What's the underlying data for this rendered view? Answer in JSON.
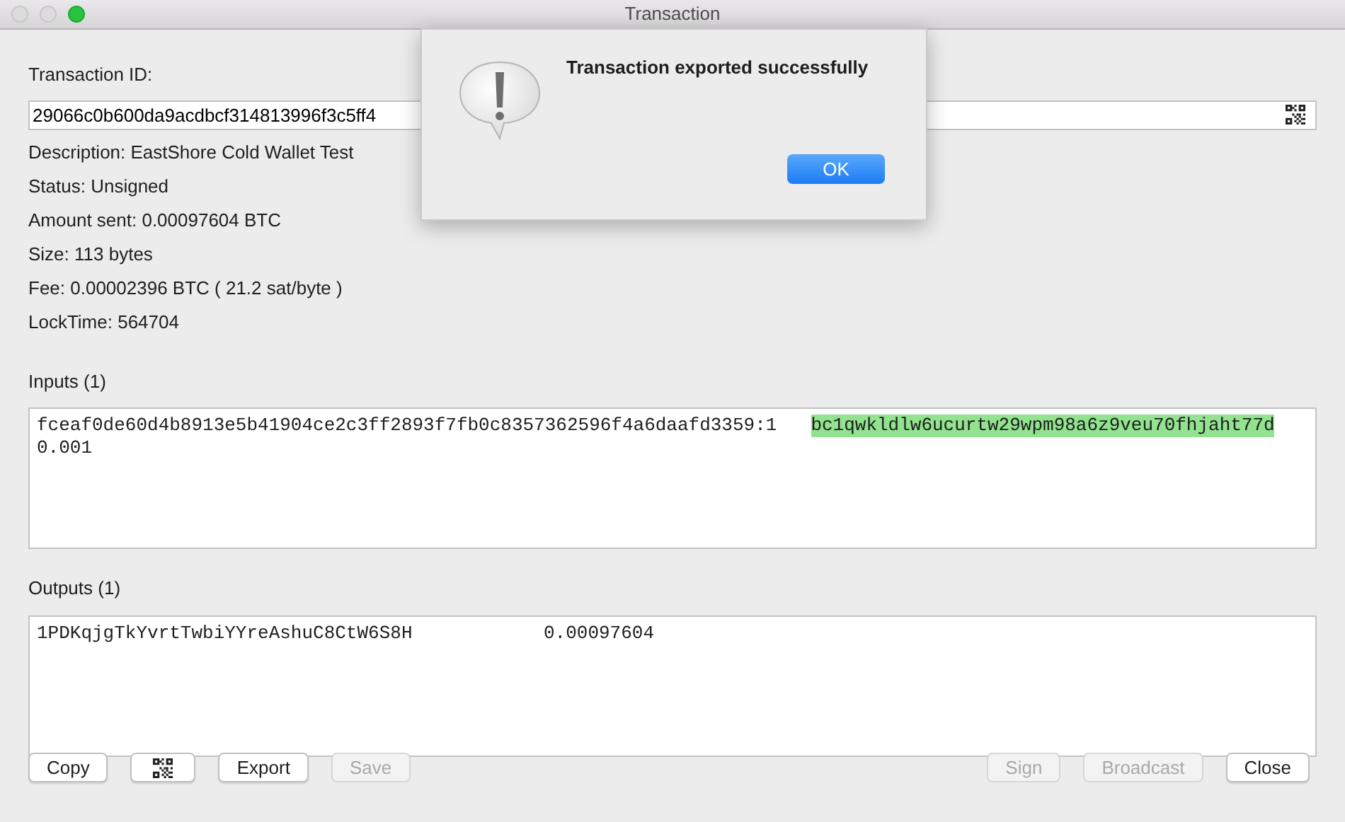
{
  "window": {
    "title": "Transaction"
  },
  "transaction_id": {
    "label": "Transaction ID:",
    "value": "29066c0b600da9acdbcf314813996f3c5ff4"
  },
  "details": [
    "Description: EastShore Cold Wallet Test",
    "Status: Unsigned",
    "Amount sent: 0.00097604 BTC",
    "Size: 113 bytes",
    "Fee: 0.00002396 BTC  ( 21.2 sat/byte )",
    "LockTime: 564704"
  ],
  "inputs": {
    "label": "Inputs (1)",
    "rows": [
      {
        "outpoint": "fceaf0de60d4b8913e5b41904ce2c3ff2893f7fb0c8357362596f4a6daafd3359:1",
        "address": "bc1qwkldlw6ucurtw29wpm98a6z9veu70fhjaht77d",
        "highlighted": true,
        "amount": "0.001"
      }
    ]
  },
  "outputs": {
    "label": "Outputs (1)",
    "rows": [
      {
        "address": "1PDKqjgTkYvrtTwbiYYreAshuC8CtW6S8H",
        "amount": "0.00097604"
      }
    ]
  },
  "left_buttons": [
    {
      "kind": "text",
      "label": "Copy",
      "disabled": false
    },
    {
      "kind": "qr",
      "disabled": false
    },
    {
      "kind": "text",
      "label": "Export",
      "disabled": false
    },
    {
      "kind": "text",
      "label": "Save",
      "disabled": true
    }
  ],
  "right_buttons": [
    {
      "kind": "text",
      "label": "Sign",
      "disabled": true
    },
    {
      "kind": "text",
      "label": "Broadcast",
      "disabled": true
    },
    {
      "kind": "text",
      "label": "Close",
      "disabled": false
    }
  ],
  "dialog": {
    "message": "Transaction exported successfully",
    "button": "OK"
  }
}
